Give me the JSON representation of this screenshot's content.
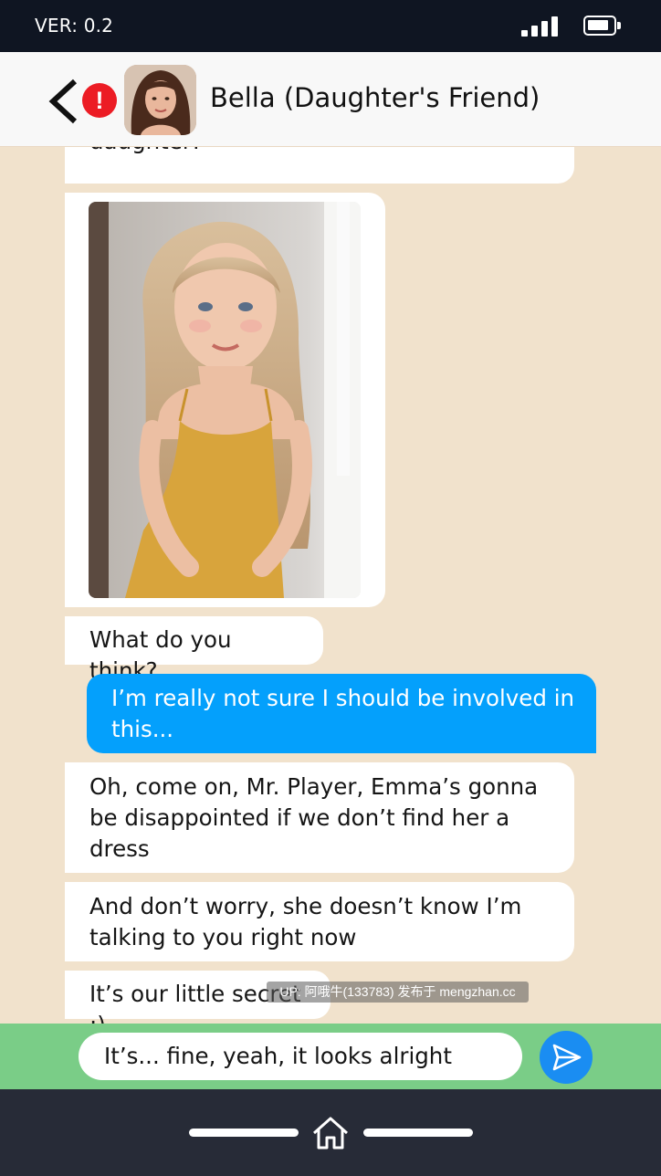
{
  "status_bar": {
    "version": "VER: 0.2"
  },
  "header": {
    "contact_name": "Bella (Daughter's Friend)",
    "alert_symbol": "!"
  },
  "messages": [
    {
      "from": "contact",
      "text": "daughter!"
    },
    {
      "from": "contact",
      "type": "image",
      "description_icon": "photo-image"
    },
    {
      "from": "contact",
      "text": "What do you think?"
    },
    {
      "from": "player",
      "text": "I’m really not sure I should be involved in this..."
    },
    {
      "from": "contact",
      "text": "Oh, come on, Mr. Player, Emma’s gonna be disappointed if we don’t find her a dress"
    },
    {
      "from": "contact",
      "text": "And don’t worry, she doesn’t know I’m talking to you right now"
    },
    {
      "from": "contact",
      "text": "It’s our little secret ;)"
    }
  ],
  "watermark": "UP: 阿哦牛(133783) 发布于 mengzhan.cc",
  "composer": {
    "value": "It’s... fine, yeah, it looks alright"
  },
  "colors": {
    "status_bar": "#0f1522",
    "chat_bg": "#f1e2cc",
    "sent_bubble": "#04a0fc",
    "composer_bar": "#7acd87",
    "send_button": "#1a8df2",
    "nav_bar": "#272b37",
    "alert": "#ec1c24"
  },
  "icons": [
    "signal-icon",
    "battery-icon",
    "back-arrow-icon",
    "alert-icon",
    "send-icon",
    "home-icon"
  ]
}
